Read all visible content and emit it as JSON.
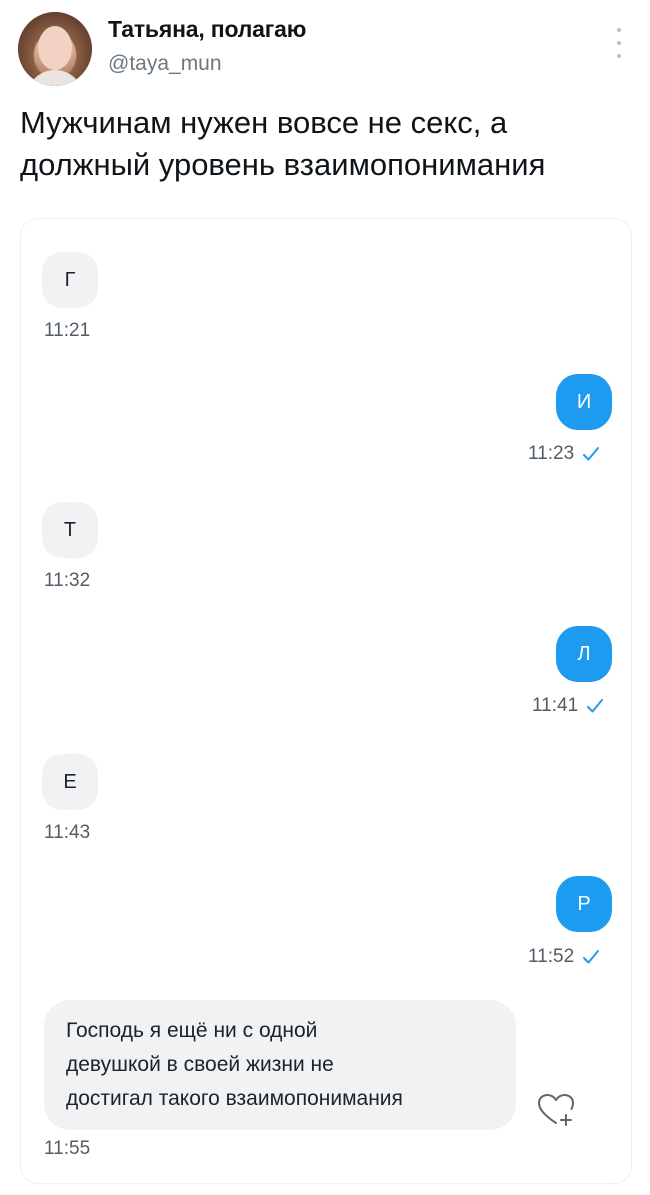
{
  "header": {
    "display_name": "Татьяна, полагаю",
    "handle": "@taya_mun",
    "more_icon": "more-vertical-icon",
    "avatar": "profile-photo"
  },
  "tweet": {
    "text_line1": "Мужчинам нужен вовсе не секс, а",
    "text_line2": "должный уровень взаимопонимания"
  },
  "chat": {
    "colors": {
      "outgoing": "#1d9bf0",
      "incoming": "#f1f2f4",
      "check": "#1d9bf0"
    },
    "messages": [
      {
        "text": "Г",
        "time": "11:21",
        "direction": "incoming"
      },
      {
        "text": "И",
        "time": "11:23",
        "direction": "outgoing",
        "read": true
      },
      {
        "text": "Т",
        "time": "11:32",
        "direction": "incoming"
      },
      {
        "text": "Л",
        "time": "11:41",
        "direction": "outgoing",
        "read": true
      },
      {
        "text": "Е",
        "time": "11:43",
        "direction": "incoming"
      },
      {
        "text": "Р",
        "time": "11:52",
        "direction": "outgoing",
        "read": true
      }
    ],
    "last_message": {
      "line1": "Господь я ещё ни с одной",
      "line2": "девушкой в своей жизни не",
      "line3": "достигал такого взаимопонимания",
      "time": "11:55",
      "reaction_icon": "heart-plus-icon"
    }
  }
}
